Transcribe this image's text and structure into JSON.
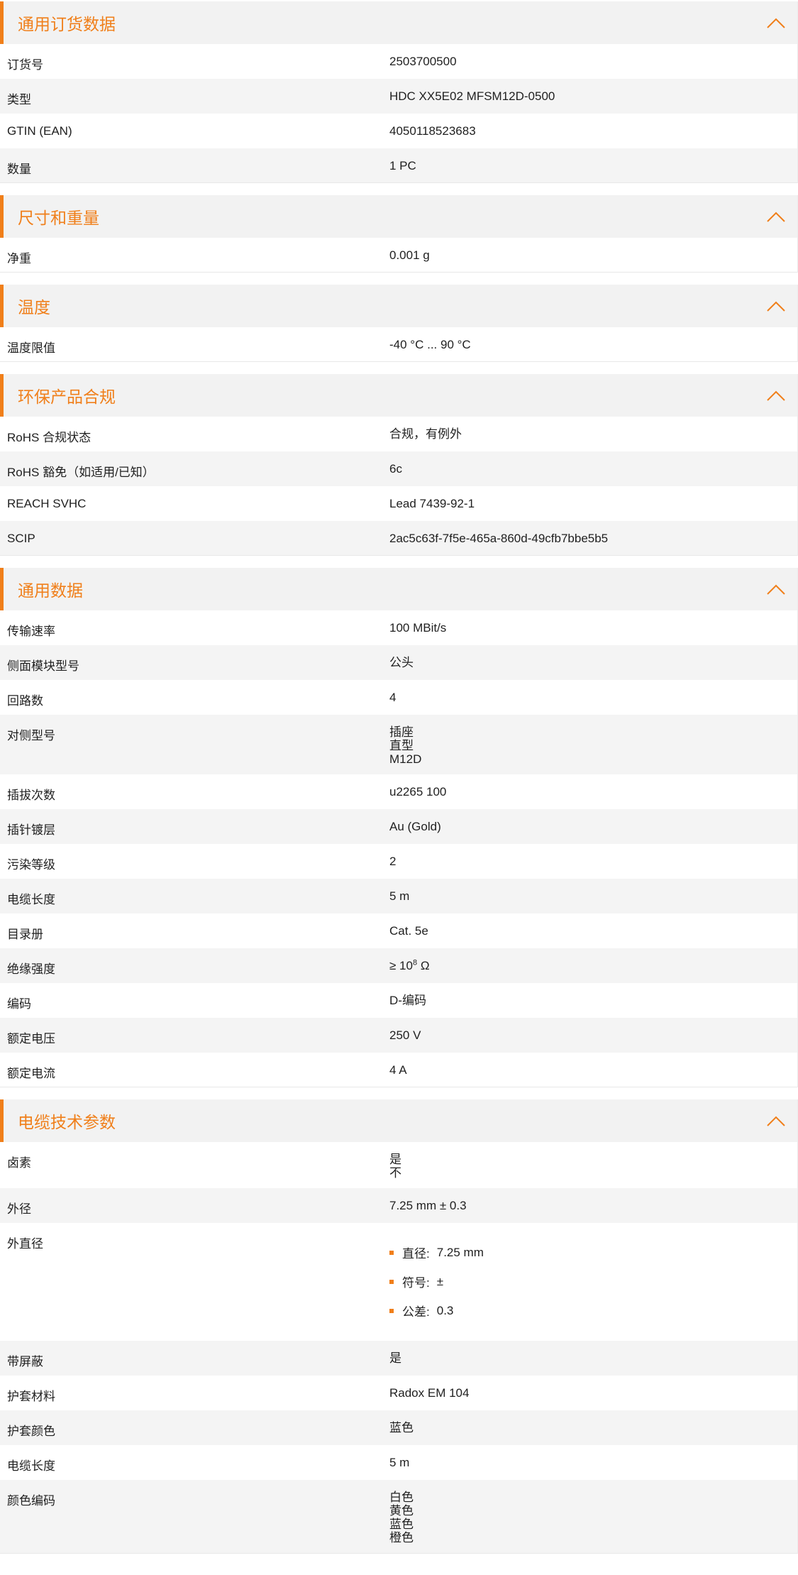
{
  "sections": [
    {
      "title": "通用订货数据",
      "rows": [
        {
          "label": "订货号",
          "value": [
            "2503700500"
          ]
        },
        {
          "label": "类型",
          "value": [
            "HDC XX5E02 MFSM12D-0500"
          ]
        },
        {
          "label": "GTIN (EAN)",
          "value": [
            "4050118523683"
          ]
        },
        {
          "label": "数量",
          "value": [
            "1  PC"
          ]
        }
      ]
    },
    {
      "title": "尺寸和重量",
      "rows": [
        {
          "label": "净重",
          "value": [
            "0.001  g"
          ]
        }
      ]
    },
    {
      "title": "温度",
      "rows": [
        {
          "label": "温度限值",
          "value": [
            "-40 °C ... 90 °C"
          ]
        }
      ]
    },
    {
      "title": "环保产品合规",
      "rows": [
        {
          "label": "RoHS 合规状态",
          "value": [
            "合规，有例外"
          ]
        },
        {
          "label": "RoHS 豁免（如适用/已知）",
          "value": [
            "6c"
          ]
        },
        {
          "label": "REACH SVHC",
          "value": [
            "Lead 7439-92-1"
          ]
        },
        {
          "label": "SCIP",
          "value": [
            "2ac5c63f-7f5e-465a-860d-49cfb7bbe5b5"
          ]
        }
      ]
    },
    {
      "title": "通用数据",
      "rows": [
        {
          "label": "传输速率",
          "value": [
            "100 MBit/s"
          ]
        },
        {
          "label": "侧面模块型号",
          "value": [
            "公头"
          ]
        },
        {
          "label": "回路数",
          "value": [
            "4"
          ]
        },
        {
          "label": "对侧型号",
          "value": [
            "插座",
            "直型",
            "M12D"
          ]
        },
        {
          "label": "插拔次数",
          "value": [
            "u2265 100"
          ]
        },
        {
          "label": "插针镀层",
          "value": [
            "Au (Gold)"
          ]
        },
        {
          "label": "污染等级",
          "value": [
            "2"
          ]
        },
        {
          "label": "电缆长度",
          "value": [
            "5  m"
          ]
        },
        {
          "label": "目录册",
          "value": [
            "Cat. 5e"
          ]
        },
        {
          "label": "绝缘强度",
          "value": [
            "≥ 10"
          ],
          "sup": "8",
          "suffix": " Ω"
        },
        {
          "label": "编码",
          "value": [
            "D-编码"
          ]
        },
        {
          "label": "额定电压",
          "value": [
            "250  V"
          ]
        },
        {
          "label": "额定电流",
          "value": [
            "4  A"
          ]
        }
      ]
    },
    {
      "title": "电缆技术参数",
      "rows": [
        {
          "label": "卤素",
          "value": [
            "是",
            "不"
          ]
        },
        {
          "label": "外径",
          "value": [
            "7.25 mm ± 0.3"
          ]
        },
        {
          "label": "外直径",
          "bullets": [
            {
              "key": "直径:",
              "val": "7.25 mm"
            },
            {
              "key": "符号:",
              "val": "±"
            },
            {
              "key": "公差:",
              "val": "0.3"
            }
          ]
        },
        {
          "label": "带屏蔽",
          "value": [
            "是"
          ]
        },
        {
          "label": "护套材料",
          "value": [
            "Radox EM 104"
          ]
        },
        {
          "label": "护套颜色",
          "value": [
            "蓝色"
          ]
        },
        {
          "label": "电缆长度",
          "value": [
            "5  m"
          ]
        },
        {
          "label": "颜色编码",
          "value": [
            "白色",
            "黄色",
            "蓝色",
            "橙色"
          ]
        }
      ]
    }
  ],
  "icons": {
    "collapse": "chevron-up-icon"
  },
  "colors": {
    "accent": "#f07f1a",
    "header_bg": "#f2f2f2",
    "row_alt_bg": "#f4f4f4"
  }
}
